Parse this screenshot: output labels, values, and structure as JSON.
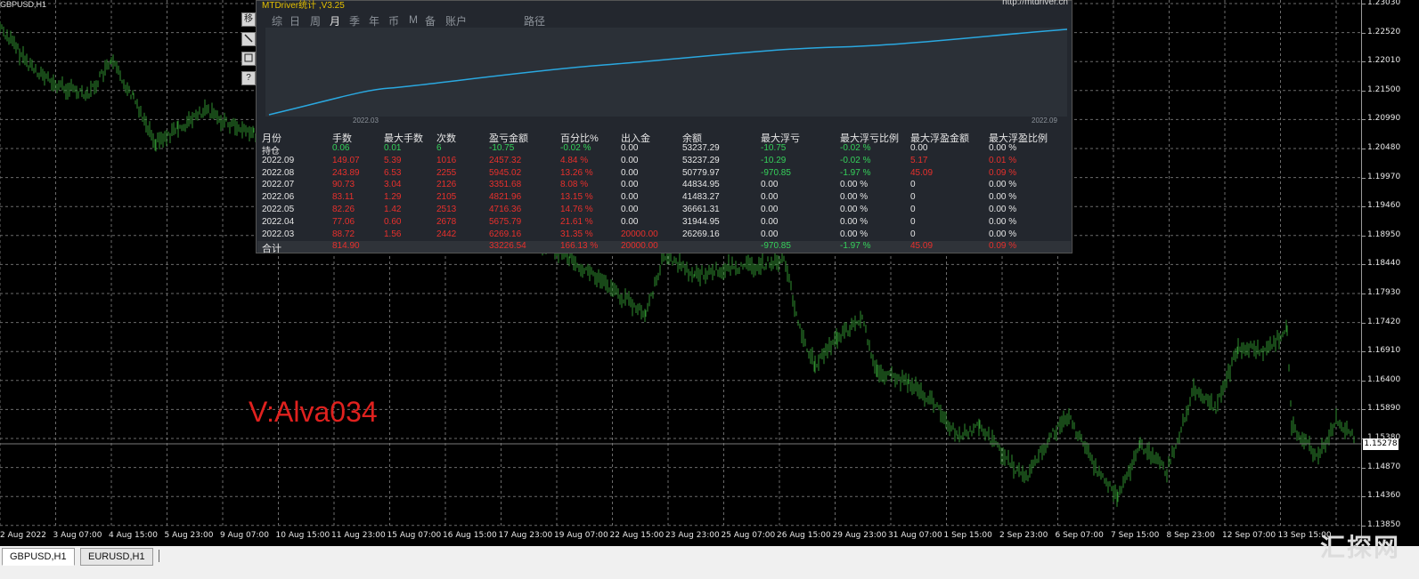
{
  "chart": {
    "title": "GBPUSD,H1",
    "candle_color": "#2f8f2f",
    "grid_color": "#6b6b6b",
    "current_price": "1.15278",
    "price_labels": [
      "1.23030",
      "1.22520",
      "1.22010",
      "1.21500",
      "1.20990",
      "1.20480",
      "1.19970",
      "1.19460",
      "1.18950",
      "1.18440",
      "1.17930",
      "1.17420",
      "1.16910",
      "1.16400",
      "1.15890",
      "1.15380",
      "1.14870",
      "1.14360",
      "1.13850"
    ],
    "time_labels": [
      "2 Aug 2022",
      "3 Aug 07:00",
      "4 Aug 15:00",
      "5 Aug 23:00",
      "9 Aug 07:00",
      "10 Aug 15:00",
      "11 Aug 23:00",
      "15 Aug 07:00",
      "16 Aug 15:00",
      "17 Aug 23:00",
      "19 Aug 07:00",
      "22 Aug 15:00",
      "23 Aug 23:00",
      "25 Aug 07:00",
      "26 Aug 15:00",
      "29 Aug 23:00",
      "31 Aug 07:00",
      "1 Sep 15:00",
      "2 Sep 23:00",
      "6 Sep 07:00",
      "7 Sep 15:00",
      "8 Sep 23:00",
      "12 Sep 07:00",
      "13 Sep 15:00"
    ],
    "overlay_text": "V:Alva034"
  },
  "tool_buttons": [
    "移",
    "",
    "",
    "?"
  ],
  "stats": {
    "title": "MTDriver统计 ,V3.25",
    "url": "http://mtdriver.cn",
    "tabs": [
      "综",
      "日",
      "周",
      "月",
      "季",
      "年",
      "币",
      "M",
      "备",
      "账户",
      "路径"
    ],
    "active_tab": "月",
    "equity_start": "2022.03",
    "equity_end": "2022.09",
    "equity_line_color": "#2aa8e0",
    "headers": [
      "月份",
      "手数",
      "最大手数",
      "次数",
      "盈亏金额",
      "百分比%",
      "出入金",
      "余额",
      "最大浮亏",
      "最大浮亏比例",
      "最大浮盈金额",
      "最大浮盈比例"
    ],
    "rows": [
      {
        "c": [
          "持仓",
          "0.06",
          "0.01",
          "6",
          "-10.75",
          "-0.02 %",
          "0.00",
          "53237.29",
          "-10.75",
          "-0.02 %",
          "0.00",
          "0.00 %"
        ],
        "cls": [
          "w",
          "g",
          "g",
          "g",
          "g",
          "g",
          "w",
          "w",
          "g",
          "g",
          "w",
          "w"
        ]
      },
      {
        "c": [
          "2022.09",
          "149.07",
          "5.39",
          "1016",
          "2457.32",
          "4.84 %",
          "0.00",
          "53237.29",
          "-10.29",
          "-0.02 %",
          "5.17",
          "0.01 %"
        ],
        "cls": [
          "w",
          "r",
          "r",
          "r",
          "r",
          "r",
          "w",
          "w",
          "g",
          "g",
          "r",
          "r"
        ]
      },
      {
        "c": [
          "2022.08",
          "243.89",
          "6.53",
          "2255",
          "5945.02",
          "13.26 %",
          "0.00",
          "50779.97",
          "-970.85",
          "-1.97 %",
          "45.09",
          "0.09 %"
        ],
        "cls": [
          "w",
          "r",
          "r",
          "r",
          "r",
          "r",
          "w",
          "w",
          "g",
          "g",
          "r",
          "r"
        ]
      },
      {
        "c": [
          "2022.07",
          "90.73",
          "3.04",
          "2126",
          "3351.68",
          "8.08 %",
          "0.00",
          "44834.95",
          "0.00",
          "0.00 %",
          "0",
          "0.00 %"
        ],
        "cls": [
          "w",
          "r",
          "r",
          "r",
          "r",
          "r",
          "w",
          "w",
          "w",
          "w",
          "w",
          "w"
        ]
      },
      {
        "c": [
          "2022.06",
          "83.11",
          "1.29",
          "2105",
          "4821.96",
          "13.15 %",
          "0.00",
          "41483.27",
          "0.00",
          "0.00 %",
          "0",
          "0.00 %"
        ],
        "cls": [
          "w",
          "r",
          "r",
          "r",
          "r",
          "r",
          "w",
          "w",
          "w",
          "w",
          "w",
          "w"
        ]
      },
      {
        "c": [
          "2022.05",
          "82.26",
          "1.42",
          "2513",
          "4716.36",
          "14.76 %",
          "0.00",
          "36661.31",
          "0.00",
          "0.00 %",
          "0",
          "0.00 %"
        ],
        "cls": [
          "w",
          "r",
          "r",
          "r",
          "r",
          "r",
          "w",
          "w",
          "w",
          "w",
          "w",
          "w"
        ]
      },
      {
        "c": [
          "2022.04",
          "77.06",
          "0.60",
          "2678",
          "5675.79",
          "21.61 %",
          "0.00",
          "31944.95",
          "0.00",
          "0.00 %",
          "0",
          "0.00 %"
        ],
        "cls": [
          "w",
          "r",
          "r",
          "r",
          "r",
          "r",
          "w",
          "w",
          "w",
          "w",
          "w",
          "w"
        ]
      },
      {
        "c": [
          "2022.03",
          "88.72",
          "1.56",
          "2442",
          "6269.16",
          "31.35 %",
          "20000.00",
          "26269.16",
          "0.00",
          "0.00 %",
          "0",
          "0.00 %"
        ],
        "cls": [
          "w",
          "r",
          "r",
          "r",
          "r",
          "r",
          "r",
          "w",
          "w",
          "w",
          "w",
          "w"
        ]
      },
      {
        "c": [
          "合计",
          "814.90",
          "",
          "",
          "33226.54",
          "166.13 %",
          "20000.00",
          "",
          "-970.85",
          "-1.97 %",
          "45.09",
          "0.09 %"
        ],
        "cls": [
          "w",
          "r",
          "r",
          "r",
          "r",
          "r",
          "r",
          "w",
          "g",
          "g",
          "r",
          "r"
        ]
      }
    ]
  },
  "symbol_tabs": [
    "GBPUSD,H1",
    "EURUSD,H1"
  ],
  "watermark": "汇探网"
}
